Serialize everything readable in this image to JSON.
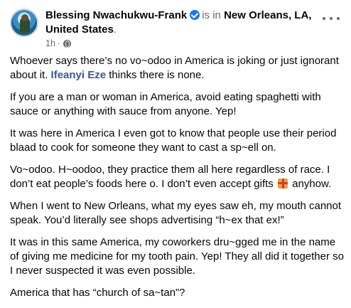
{
  "header": {
    "author_name": "Blessing Nwachukwu-Frank",
    "verified_icon": "verified-badge-icon",
    "is_in_text": "is in",
    "location": "New Orleans, LA, United States",
    "location_suffix": ".",
    "time": "1h",
    "separator": "·",
    "audience_icon": "globe-icon",
    "more_icon": "more-options-icon"
  },
  "post": {
    "p1_before": "Whoever says there’s no vo~odoo in America is joking or just ignorant about it. ",
    "p1_mention": "Ifeanyi Eze",
    "p1_after": " thinks there is none.",
    "p2": "If you are a man or woman in America, avoid eating spaghetti with sauce or anything with sauce from anyone. Yep!",
    "p3": "It was here in America I even got to know that people use their period blaad to cook for someone they want to cast a sp~ell on.",
    "p4_before": "Vo~odoo. H~oodoo, they practice them all here regardless of race. I don’t eat people’s foods here o. I don’t even accept gifts ",
    "p4_icon": "gift-emoji-icon",
    "p4_after": " anyhow.",
    "p5": "When I went to New Orleans, what my eyes saw eh, my mouth cannot speak. You’d literally see shops advertising “h~ex that ex!”",
    "p6": "It was in this same America, my coworkers dru~gged me in the name of giving me medicine for my tooth pain. Yep! They all did it together so I never suspected it was even possible.",
    "p7": "America that has “church of sa~tan”?"
  }
}
